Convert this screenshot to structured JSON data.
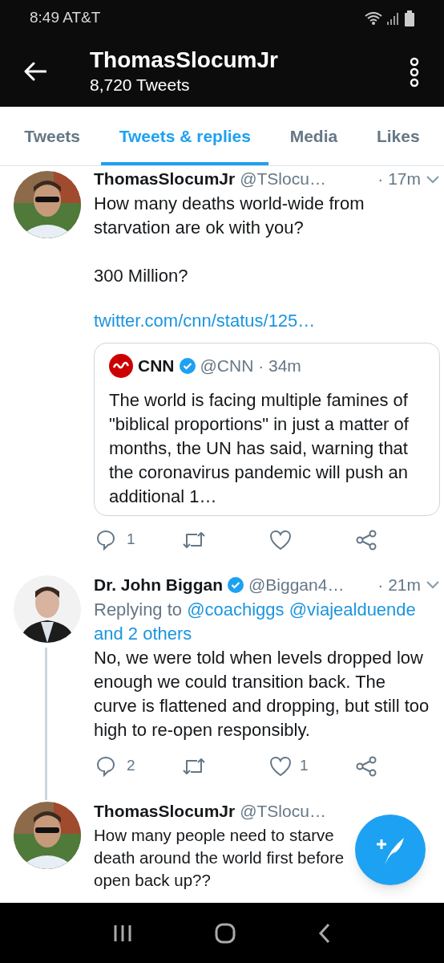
{
  "status_bar": {
    "text": "8:49 AT&T"
  },
  "header": {
    "title": "ThomasSlocumJr",
    "subtitle": "8,720 Tweets"
  },
  "tabs": [
    {
      "label": "Tweets",
      "selected": false
    },
    {
      "label": "Tweets & replies",
      "selected": true
    },
    {
      "label": "Media",
      "selected": false
    },
    {
      "label": "Likes",
      "selected": false
    }
  ],
  "tweets": [
    {
      "name": "ThomasSlocumJr",
      "handle": "@TSlocu…",
      "time": "· 17m",
      "lines": [
        "How many deaths world-wide from starvation are ok with you?\n\n300 Million?"
      ],
      "link": "twitter.com/cnn/status/125…",
      "quote": {
        "name": "CNN",
        "verified": true,
        "handle": "@CNN · 34m",
        "text": "The world is facing multiple famines of \"biblical proportions\" in just a matter of months, the UN has said, warning that the coronavirus pandemic will push an additional 1…"
      },
      "actions": [
        {
          "kind": "reply",
          "count": "1"
        },
        {
          "kind": "retweet"
        },
        {
          "kind": "like"
        },
        {
          "kind": "share"
        }
      ]
    },
    {
      "name": "Dr. John Biggan",
      "verified": true,
      "handle": "@Biggan4…",
      "time": "· 21m",
      "thread_line": true,
      "replying_label": "Replying to",
      "replying_targets": "@coachiggs @viajealduende and 2 others",
      "lines": [
        "No, we were told when levels dropped low enough we could transition back. The curve is flattened and dropping, but still too high to re-open responsibly."
      ],
      "actions": [
        {
          "kind": "reply",
          "count": "2"
        },
        {
          "kind": "retweet"
        },
        {
          "kind": "like",
          "count": "1"
        },
        {
          "kind": "share"
        }
      ]
    },
    {
      "name": "ThomasSlocumJr",
      "handle": "@TSlocu…",
      "lines": [
        "How many people need to starve",
        "death around the world first before",
        "open back up??"
      ]
    }
  ]
}
